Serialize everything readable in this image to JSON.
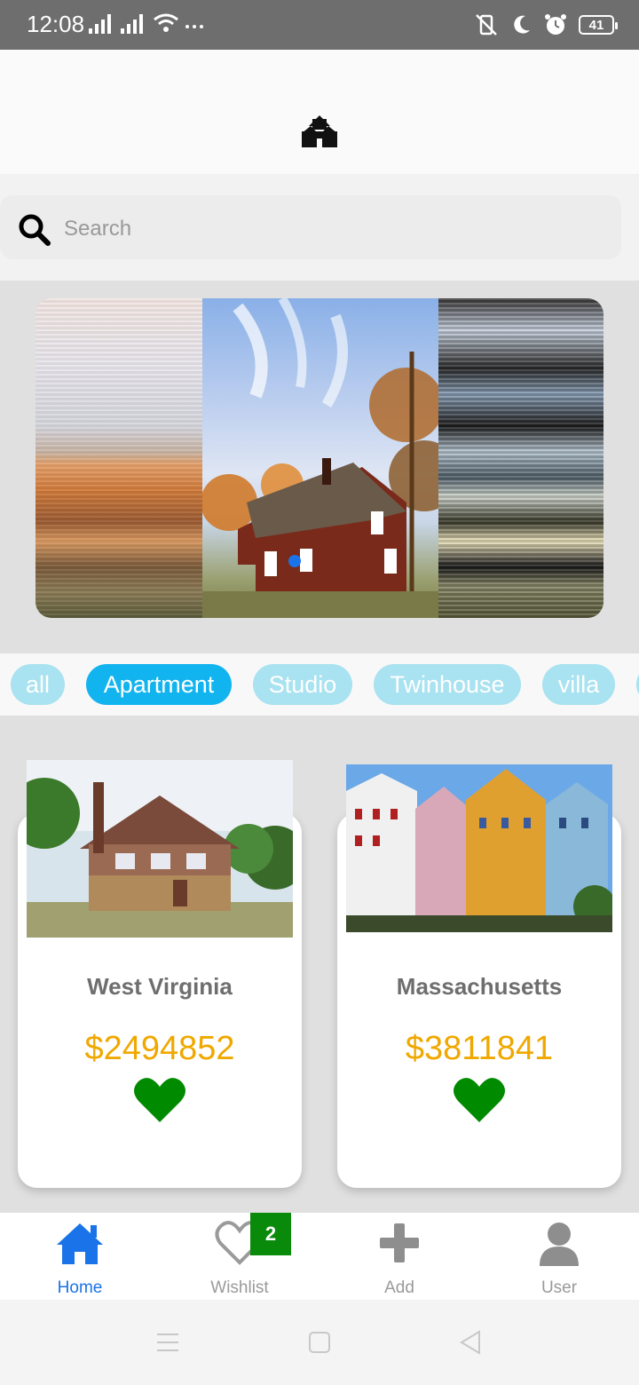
{
  "status_bar": {
    "time": "12:08",
    "battery": "41",
    "icons": [
      "signal-icon",
      "signal-icon",
      "wifi-icon",
      "more-icon",
      "vibrate-off-icon",
      "moon-icon",
      "alarm-icon",
      "battery-icon"
    ]
  },
  "header": {
    "logo_icon": "house-logo-icon"
  },
  "search": {
    "placeholder": "Search",
    "icon": "search-icon"
  },
  "carousel": {
    "active_index": 0
  },
  "categories": [
    {
      "label": "all",
      "active": false
    },
    {
      "label": "Apartment",
      "active": true
    },
    {
      "label": "Studio",
      "active": false
    },
    {
      "label": "Twinhouse",
      "active": false
    },
    {
      "label": "villa",
      "active": false
    }
  ],
  "listings": [
    {
      "title": "West Virginia",
      "price": "$2494852",
      "favorite": true
    },
    {
      "title": "Massachusetts",
      "price": "$3811841",
      "favorite": true
    }
  ],
  "bottom_nav": {
    "items": [
      {
        "label": "Home",
        "icon": "home-icon",
        "active": true
      },
      {
        "label": "Wishlist",
        "icon": "heart-outline-icon",
        "active": false
      },
      {
        "label": "Add",
        "icon": "plus-icon",
        "active": false
      },
      {
        "label": "User",
        "icon": "user-icon",
        "active": false
      }
    ],
    "wishlist_badge": "2"
  },
  "colors": {
    "accent": "#12b4ef",
    "chip_inactive": "#a9e2f0",
    "price": "#f0a800",
    "heart": "#008a00",
    "nav_active": "#1a73e8",
    "badge": "#0a8a0a"
  }
}
